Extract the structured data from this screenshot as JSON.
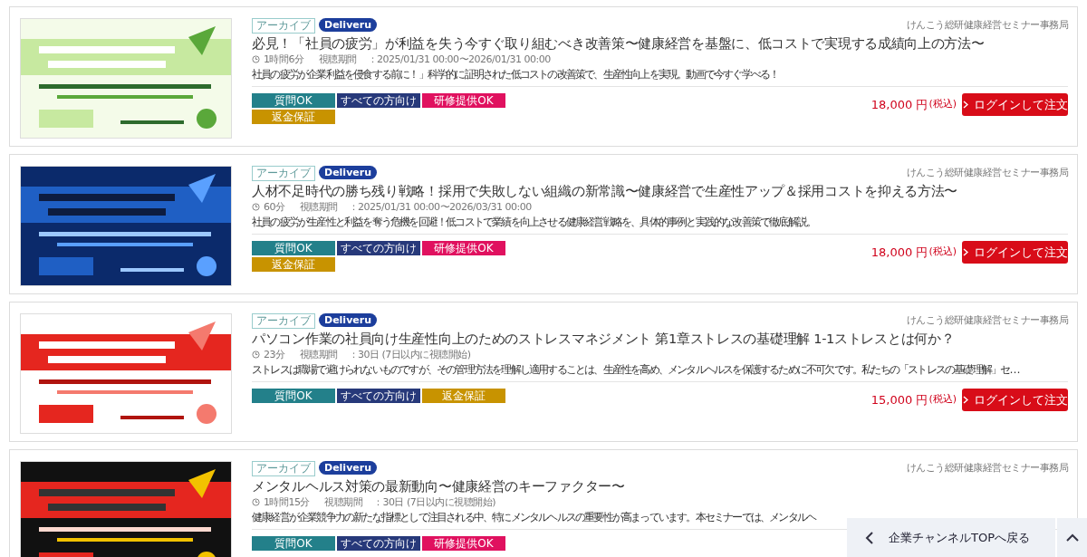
{
  "courses": [
    {
      "thumbnail": {
        "kind": "picture"
      },
      "archive_badge": "アーカイブ",
      "platform_badge": "Deliveru",
      "organizer": "けんこう総研健康経営セミナー事務局",
      "title": "必見！「社員の疲労」が利益を失う今すぐ取り組むべき改善策〜健康経営を基盤に、低コストで実現する成績向上の方法〜",
      "duration": "1時間6分",
      "period_label": "視聴期間",
      "period": "：2025/01/31 00:00〜2026/01/31 00:00",
      "description": "社員の疲労が企業利益を侵食する前に！」科学的に証明された低コストの改善策で、生産性向上を実現。動画で今すぐ学べる！",
      "tags": [
        {
          "label": "質問OK",
          "color": "#23808a"
        },
        {
          "label": "すべての方向け",
          "color": "#27397a"
        },
        {
          "label": "研修提供OK",
          "color": "#e0115f"
        },
        {
          "label": "返金保証",
          "color": "#c89300"
        }
      ],
      "price": "18,000 円",
      "tax": "(税込)",
      "order_button": "ログインして注文"
    },
    {
      "thumbnail": {
        "kind": "picture"
      },
      "archive_badge": "アーカイブ",
      "platform_badge": "Deliveru",
      "organizer": "けんこう総研健康経営セミナー事務局",
      "title": "人材不足時代の勝ち残り戦略！採用で失敗しない組織の新常識〜健康経営で生産性アップ＆採用コストを抑える方法〜",
      "duration": "60分",
      "period_label": "視聴期間",
      "period": "：2025/01/31 00:00〜2026/03/31 00:00",
      "description": "社員の疲労が生産性と利益を奪う危機を回避！低コストで業績を向上させる健康経営戦略を、具体的事例と実践的な改善策で徹底解説。",
      "tags": [
        {
          "label": "質問OK",
          "color": "#23808a"
        },
        {
          "label": "すべての方向け",
          "color": "#27397a"
        },
        {
          "label": "研修提供OK",
          "color": "#e0115f"
        },
        {
          "label": "返金保証",
          "color": "#c89300"
        }
      ],
      "price": "18,000 円",
      "tax": "(税込)",
      "order_button": "ログインして注文"
    },
    {
      "thumbnail": {
        "kind": "picture"
      },
      "archive_badge": "アーカイブ",
      "platform_badge": "Deliveru",
      "organizer": "けんこう総研健康経営セミナー事務局",
      "title": "パソコン作業の社員向け生産性向上のためのストレスマネジメント 第1章ストレスの基礎理解 1-1ストレスとは何か？",
      "duration": "23分",
      "period_label": "視聴期間",
      "period": "：30日 (7日以内に視聴開始)",
      "description": "ストレスは職場で避けられないものですが、その管理方法を理解し適用することは、生産性を高め、メンタルヘルスを保護するために不可欠です。私たちの「ストレスの基礎理解」セ…",
      "tags": [
        {
          "label": "質問OK",
          "color": "#23808a"
        },
        {
          "label": "すべての方向け",
          "color": "#27397a"
        },
        {
          "label": "返金保証",
          "color": "#c89300"
        }
      ],
      "price": "15,000 円",
      "tax": "(税込)",
      "order_button": "ログインして注文"
    },
    {
      "thumbnail": {
        "kind": "picture"
      },
      "archive_badge": "アーカイブ",
      "platform_badge": "Deliveru",
      "organizer": "けんこう総研健康経営セミナー事務局",
      "title": "メンタルヘルス対策の最新動向〜健康経営のキーファクター〜",
      "duration": "1時間15分",
      "period_label": "視聴期間",
      "period": "：30日 (7日以内に視聴開始)",
      "description": "健康経営が企業競争力の新たな指標として注目される中、特にメンタルヘルスの重要性が高まっています。本セミナーでは、メンタルヘ",
      "tags": [
        {
          "label": "質問OK",
          "color": "#23808a"
        },
        {
          "label": "すべての方向け",
          "color": "#27397a"
        },
        {
          "label": "研修提供OK",
          "color": "#e0115f"
        }
      ]
    }
  ],
  "back_bar": {
    "label": "企業チャンネルTOPへ戻る"
  }
}
